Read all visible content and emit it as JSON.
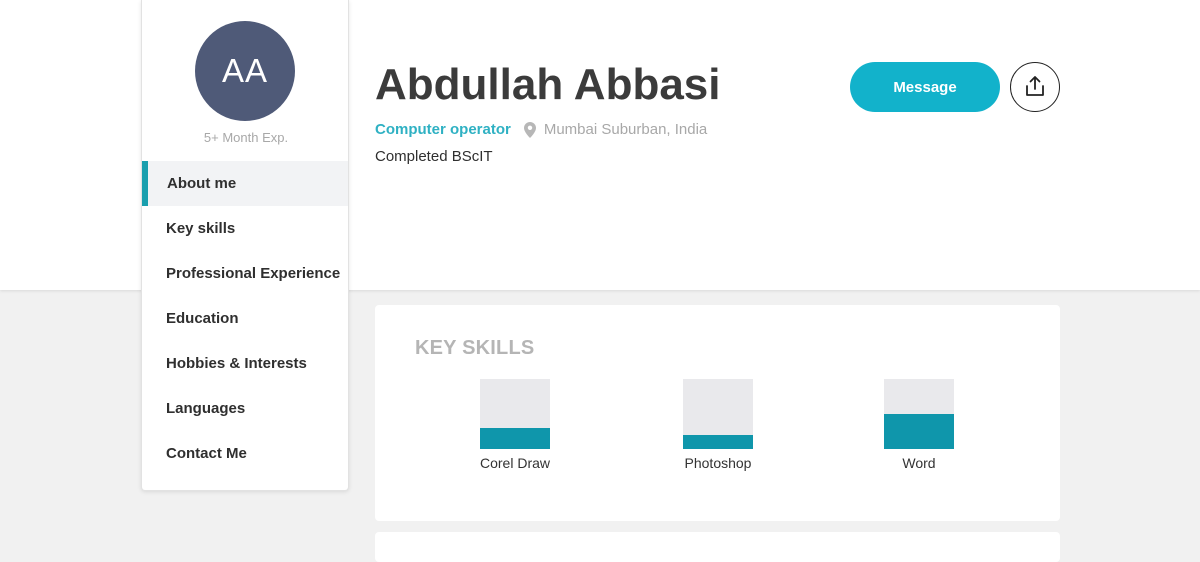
{
  "profile": {
    "initials": "AA",
    "experience": "5+ Month Exp.",
    "name": "Abdullah Abbasi",
    "role": "Computer operator",
    "location": "Mumbai Suburban, India",
    "qualification": "Completed BScIT"
  },
  "actions": {
    "message_label": "Message",
    "share_icon": "share-icon"
  },
  "nav": {
    "items": [
      {
        "label": "About me",
        "active": true
      },
      {
        "label": "Key skills",
        "active": false
      },
      {
        "label": "Professional Experience",
        "active": false
      },
      {
        "label": "Education",
        "active": false
      },
      {
        "label": "Hobbies & Interests",
        "active": false
      },
      {
        "label": "Languages",
        "active": false
      },
      {
        "label": "Contact Me",
        "active": false
      }
    ]
  },
  "skills": {
    "title": "KEY SKILLS",
    "items": [
      {
        "name": "Corel Draw",
        "level": 0.3
      },
      {
        "name": "Photoshop",
        "level": 0.2
      },
      {
        "name": "Word",
        "level": 0.5
      }
    ]
  },
  "colors": {
    "accent": "#12b2cb",
    "bar_fill": "#0f96ab",
    "avatar_bg": "#4f5a78",
    "role_text": "#2fb1c3"
  }
}
